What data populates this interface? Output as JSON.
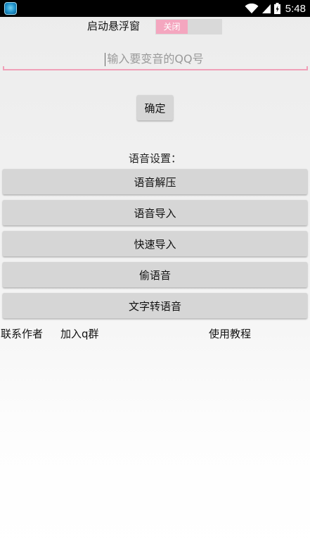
{
  "status_bar": {
    "time": "5:48",
    "icons": [
      "wifi-icon",
      "signal-icon",
      "battery-icon"
    ]
  },
  "float_window": {
    "label": "启动悬浮窗",
    "toggle_text": "关闭"
  },
  "qq_input": {
    "placeholder": "输入要变音的QQ号",
    "value": ""
  },
  "confirm_button": "确定",
  "voice_settings": {
    "label": "语音设置：",
    "buttons": [
      "语音解压",
      "语音导入",
      "快速导入",
      "偷语音",
      "文字转语音"
    ]
  },
  "links": {
    "contact_author": "联系作者",
    "join_group": "加入q群",
    "tutorial": "使用教程"
  },
  "colors": {
    "accent_pink": "#f4a6bf",
    "button_gray": "#d6d6d6",
    "status_bar": "#000000"
  }
}
